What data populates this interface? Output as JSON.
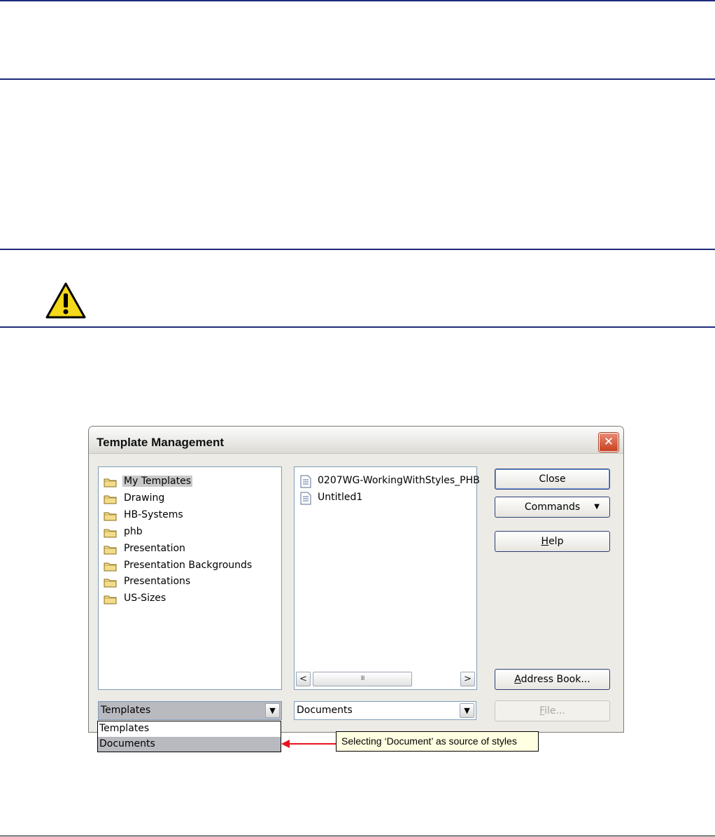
{
  "dialog": {
    "title": "Template Management",
    "close_icon": "close-icon",
    "folders": [
      {
        "label": "My Templates",
        "selected": true
      },
      {
        "label": "Drawing",
        "selected": false
      },
      {
        "label": "HB-Systems",
        "selected": false
      },
      {
        "label": "phb",
        "selected": false
      },
      {
        "label": "Presentation",
        "selected": false
      },
      {
        "label": "Presentation Backgrounds",
        "selected": false
      },
      {
        "label": "Presentations",
        "selected": false
      },
      {
        "label": "US-Sizes",
        "selected": false
      }
    ],
    "documents": [
      {
        "label": "0207WG-WorkingWithStyles_PHB"
      },
      {
        "label": "Untitled1"
      }
    ],
    "scroll_thumb_label": "III",
    "buttons": {
      "close": "Close",
      "commands": "Commands",
      "help": "Help",
      "address_book": "Address Book...",
      "file": "File..."
    },
    "left_combo": {
      "value": "Templates",
      "options": [
        "Templates",
        "Documents"
      ],
      "highlighted": "Documents"
    },
    "right_combo": {
      "value": "Documents"
    }
  },
  "callout": {
    "text": "Selecting ‘Document’ as source of styles"
  },
  "colors": {
    "rule": "#1f2a7a",
    "callout_bg": "#ffffe1",
    "callout_arrow": "#e8141e",
    "highlight": "#b9b9c0"
  },
  "icons": {
    "warning": "warning-icon",
    "folder": "folder-icon",
    "document": "document-icon"
  }
}
